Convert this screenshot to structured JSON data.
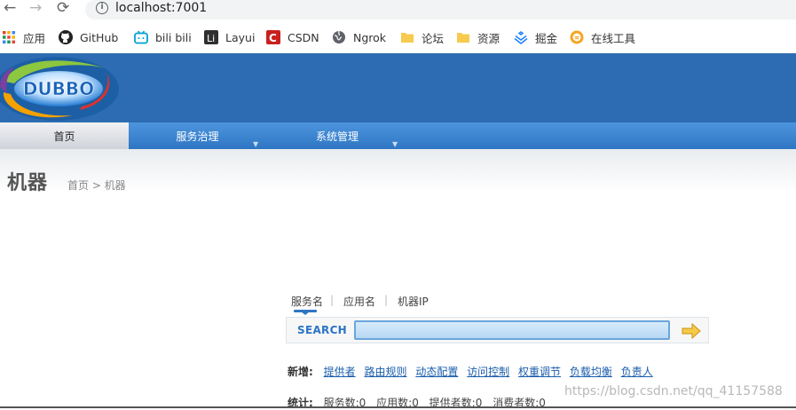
{
  "browser": {
    "url": "localhost:7001",
    "bookmarks": [
      {
        "label": "应用",
        "icon": "apps-grid-icon"
      },
      {
        "label": "GitHub",
        "icon": "github-icon"
      },
      {
        "label": "bili bili",
        "icon": "bilibili-icon"
      },
      {
        "label": "Layui",
        "icon": "layui-icon"
      },
      {
        "label": "CSDN",
        "icon": "csdn-icon"
      },
      {
        "label": "Ngrok",
        "icon": "globe-icon"
      },
      {
        "label": "论坛",
        "icon": "folder-icon"
      },
      {
        "label": "资源",
        "icon": "folder-icon"
      },
      {
        "label": "掘金",
        "icon": "juejin-icon"
      },
      {
        "label": "在线工具",
        "icon": "tool-icon"
      }
    ]
  },
  "header": {
    "logo_text": "DUBBO"
  },
  "menu": {
    "items": [
      {
        "label": "首页",
        "active": true
      },
      {
        "label": "服务治理",
        "has_dropdown": true
      },
      {
        "label": "系统管理",
        "has_dropdown": true
      }
    ]
  },
  "page": {
    "title": "机器",
    "breadcrumb": "首页 > 机器"
  },
  "search": {
    "tabs": [
      "服务名",
      "应用名",
      "机器IP"
    ],
    "active_tab": "服务名",
    "label": "SEARCH",
    "value": ""
  },
  "add": {
    "label": "新增:",
    "links": [
      "提供者",
      "路由规则",
      "动态配置",
      "访问控制",
      "权重调节",
      "负载均衡",
      "负责人"
    ]
  },
  "stats": {
    "label": "统计:",
    "items": [
      "服务数:0",
      "应用数:0",
      "提供者数:0",
      "消费者数:0"
    ]
  },
  "watermark": "https://blog.csdn.net/qq_41157588",
  "colors": {
    "header_blue": "#2d6cb2",
    "menu_blue": "#3a82d0",
    "link_blue": "#1a5dab"
  }
}
